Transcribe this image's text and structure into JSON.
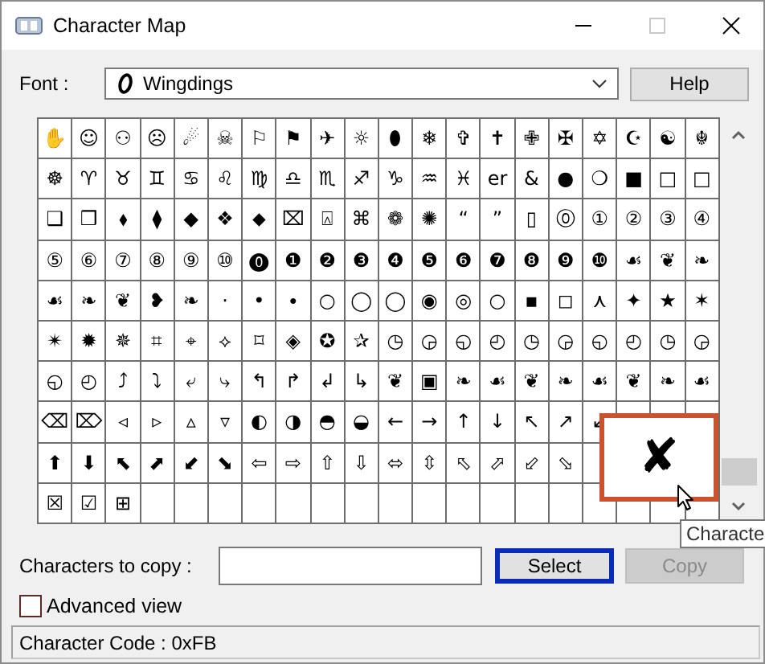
{
  "window": {
    "title": "Character Map"
  },
  "font": {
    "label": "Font :",
    "value": "Wingdings"
  },
  "help_button": "Help",
  "grid": {
    "rows": [
      [
        "✋",
        "☺",
        "⚇",
        "☹",
        "☄",
        "☠",
        "⚐",
        "⚑",
        "✈",
        "☼",
        "⬮",
        "❄",
        "✞",
        "✝",
        "✙",
        "✠",
        "✡",
        "☪",
        "☯",
        "☬"
      ],
      [
        "☸",
        "♈",
        "♉",
        "♊",
        "♋",
        "♌",
        "♍",
        "♎",
        "♏",
        "♐",
        "♑",
        "♒",
        "♓",
        "er",
        "&",
        "●",
        "❍",
        "■",
        "□",
        "□"
      ],
      [
        "❑",
        "❒",
        "⬧",
        "⧫",
        "◆",
        "❖",
        "⬥",
        "⌧",
        "⍓",
        "⌘",
        "❁",
        "✺",
        "“",
        "”",
        "▯",
        "⓪",
        "①",
        "②",
        "③",
        "④"
      ],
      [
        "⑤",
        "⑥",
        "⑦",
        "⑧",
        "⑨",
        "⑩",
        "⓿",
        "❶",
        "❷",
        "❸",
        "❹",
        "❺",
        "❻",
        "❼",
        "❽",
        "❾",
        "❿",
        "☙",
        "❦",
        "❧"
      ],
      [
        "☙",
        "❧",
        "❦",
        "❥",
        "❧",
        "·",
        "•",
        "∙",
        "○",
        "◯",
        "◯",
        "◉",
        "◎",
        "○",
        "▪",
        "◻",
        "⋏",
        "✦",
        "★",
        "✶"
      ],
      [
        "✴",
        "✹",
        "✵",
        "⌗",
        "⌖",
        "⟡",
        "⌑",
        "◈",
        "✪",
        "✰",
        "◷",
        "◶",
        "◵",
        "◴",
        "◷",
        "◶",
        "◵",
        "◴",
        "◷",
        "◶"
      ],
      [
        "◵",
        "◴",
        "⤴",
        "⤵",
        "⤶",
        "⤷",
        "↰",
        "↱",
        "↲",
        "↳",
        "❦",
        "▣",
        "❧",
        "☙",
        "❦",
        "❧",
        "☙",
        "❦",
        "❧",
        "☙"
      ],
      [
        "⌫",
        "⌦",
        "◃",
        "▹",
        "▵",
        "▿",
        "◐",
        "◑",
        "◓",
        "◒",
        "←",
        "→",
        "↑",
        "↓",
        "↖",
        "↗",
        "↙"
      ],
      [
        "⬆",
        "⬇",
        "⬉",
        "⬈",
        "⬋",
        "⬊",
        "⇦",
        "⇨",
        "⇧",
        "⇩",
        "⬄",
        "⇳",
        "⬁",
        "⬀",
        "⬃",
        "⬂"
      ],
      [
        "☒",
        "☑",
        "⊞"
      ]
    ]
  },
  "magnified": "✘",
  "tooltip": "Characte",
  "copy_field": {
    "label": "Characters to copy :"
  },
  "select_button": {
    "label": "Select",
    "focused": true
  },
  "copy_button": {
    "label": "Copy",
    "disabled": true
  },
  "advanced_view": {
    "label": "Advanced view",
    "checked": false
  },
  "status_bar": "Character Code : 0xFB"
}
